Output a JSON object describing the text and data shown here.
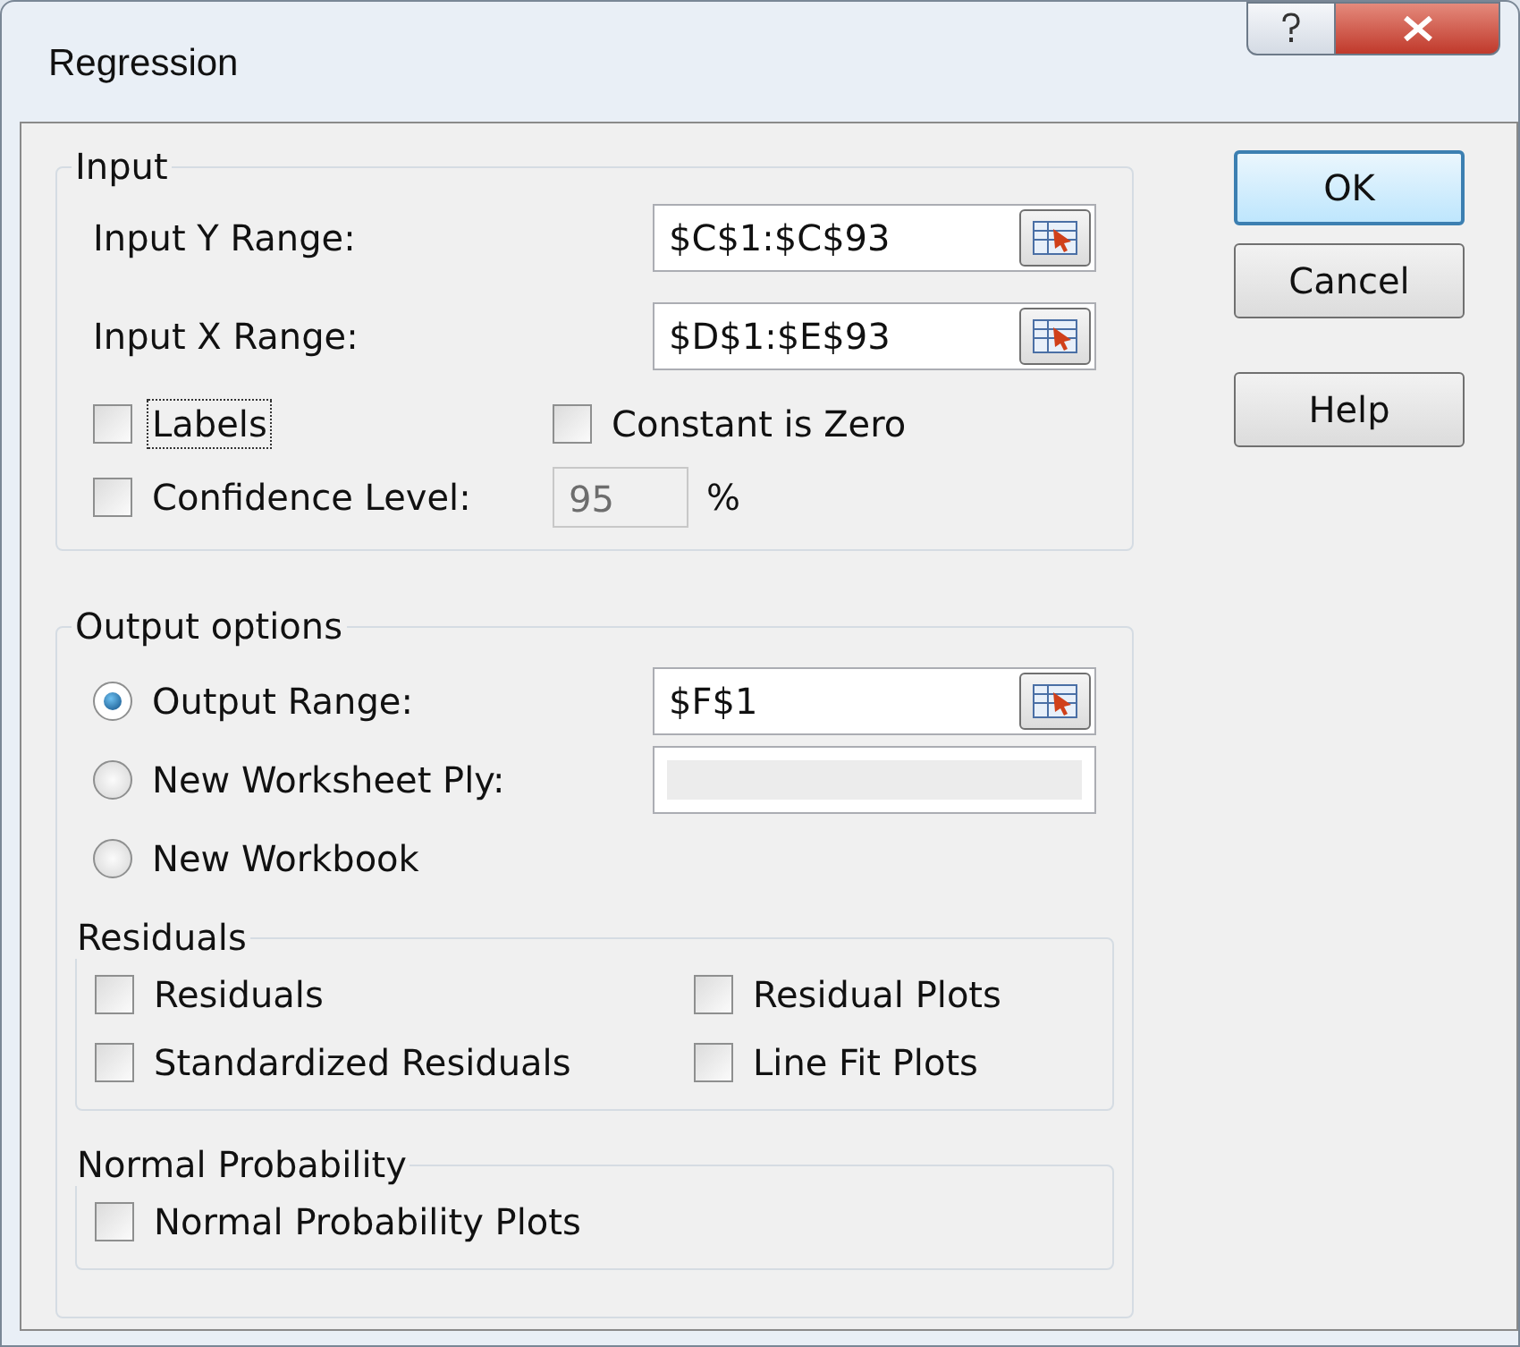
{
  "window": {
    "title": "Regression"
  },
  "input": {
    "title": "Input",
    "ranges": [
      {
        "label": "Input Y Range:",
        "value": "$C$1:$C$93"
      },
      {
        "label": "Input X Range:",
        "value": "$D$1:$E$93"
      }
    ],
    "options": [
      {
        "label": "Labels",
        "checked": false,
        "focused": true
      },
      {
        "label": "Constant is Zero",
        "checked": false,
        "focused": false
      },
      {
        "label": "Confidence Level:",
        "checked": false,
        "focused": false
      }
    ],
    "confidence": {
      "value": "95",
      "disabled": true,
      "unit": "%"
    }
  },
  "output": {
    "title": "Output options",
    "destinations": [
      {
        "kind": "range",
        "label": "Output Range:",
        "selected": true,
        "value": "$F$1"
      },
      {
        "kind": "name",
        "label": "New Worksheet Ply:",
        "selected": false
      },
      {
        "kind": "none",
        "label": "New Workbook",
        "selected": false
      }
    ],
    "groups": [
      {
        "title": "Residuals",
        "options": [
          {
            "label": "Residuals",
            "checked": false
          },
          {
            "label": "Residual Plots",
            "checked": false
          },
          {
            "label": "Standardized Residuals",
            "checked": false
          },
          {
            "label": "Line Fit Plots",
            "checked": false
          }
        ]
      },
      {
        "title": "Normal Probability",
        "options": [
          {
            "label": "Normal Probability Plots",
            "checked": false
          }
        ]
      }
    ]
  },
  "buttons": [
    {
      "kind": "ok",
      "label": "OK",
      "default": true
    },
    {
      "kind": "cancel",
      "label": "Cancel",
      "default": false
    },
    {
      "kind": "help",
      "label": "Help",
      "default": false
    }
  ]
}
